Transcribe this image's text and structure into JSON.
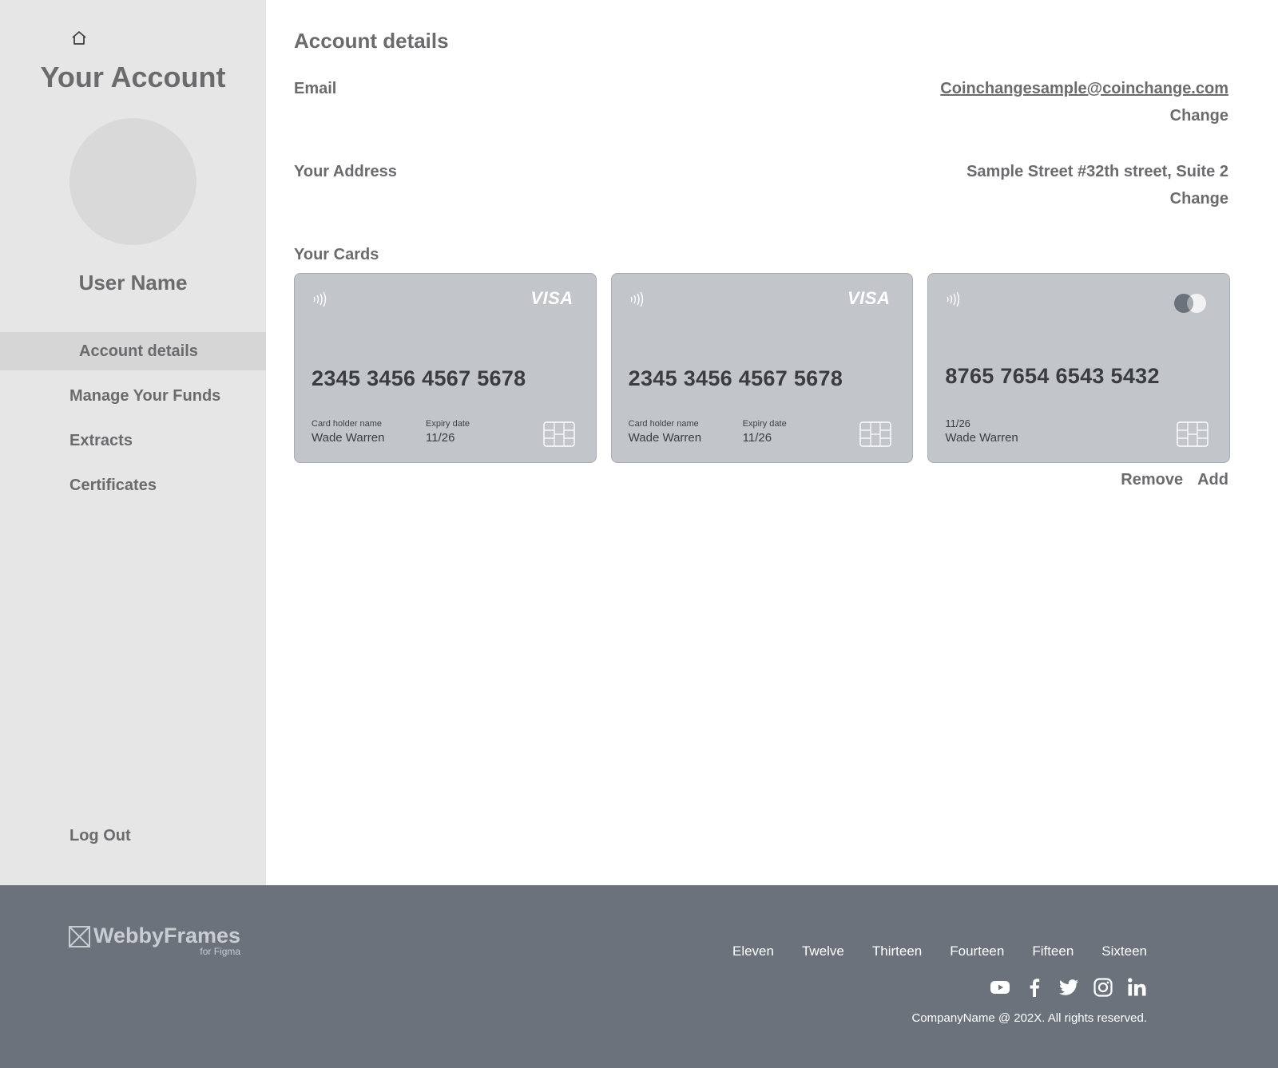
{
  "sidebar": {
    "title": "Your Account",
    "user_name": "User Name",
    "items": [
      {
        "label": "Account details",
        "active": true
      },
      {
        "label": "Manage Your Funds",
        "active": false
      },
      {
        "label": "Extracts",
        "active": false
      },
      {
        "label": "Certificates",
        "active": false
      }
    ],
    "logout_label": "Log Out"
  },
  "main": {
    "title": "Account details",
    "email": {
      "label": "Email",
      "value": "Coinchangesample@coinchange.com",
      "change_label": "Change"
    },
    "address": {
      "label": "Your Address",
      "value": "Sample Street #32th street, Suite 2",
      "change_label": "Change"
    },
    "cards_label": "Your Cards",
    "cards": [
      {
        "brand": "VISA",
        "number": "2345 3456 4567 5678",
        "holder_label": "Card holder name",
        "holder": "Wade Warren",
        "expiry_label": "Expiry date",
        "expiry": "11/26"
      },
      {
        "brand": "VISA",
        "number": "2345 3456 4567 5678",
        "holder_label": "Card holder name",
        "holder": "Wade Warren",
        "expiry_label": "Expiry date",
        "expiry": "11/26"
      },
      {
        "brand": "mastercard-logo",
        "number": "8765 7654 6543 5432",
        "expiry": "11/26",
        "holder": "Wade Warren"
      }
    ],
    "remove_label": "Remove",
    "add_label": "Add"
  },
  "footer": {
    "brand_name": "WebbyFrames",
    "brand_sub": "for Figma",
    "links": [
      "Eleven",
      "Twelve",
      "Thirteen",
      "Fourteen",
      "Fifteen",
      "Sixteen"
    ],
    "socials": [
      "youtube-icon",
      "facebook-icon",
      "twitter-icon",
      "instagram-icon",
      "linkedin-icon"
    ],
    "copyright": "CompanyName @ 202X. All rights reserved."
  },
  "colors": {
    "sidebar_bg": "#e6e6e6",
    "active_item_bg": "#d6d6d6",
    "card_bg": "#c2c6cb",
    "footer_bg": "#6b727c",
    "text": "#6b6b6e"
  }
}
